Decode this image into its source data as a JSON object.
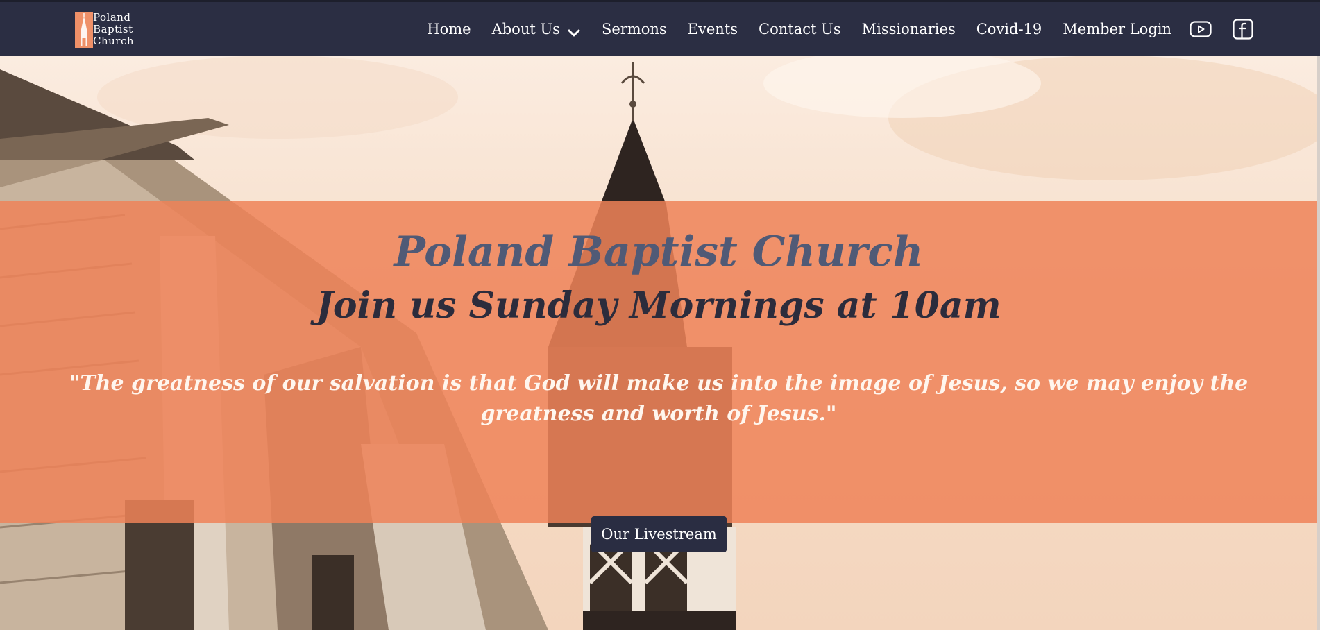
{
  "logo": {
    "lines": [
      "Poland",
      "Baptist",
      "Church"
    ]
  },
  "nav": {
    "items": [
      {
        "label": "Home"
      },
      {
        "label": "About Us"
      },
      {
        "label": "Sermons"
      },
      {
        "label": "Events"
      },
      {
        "label": "Contact Us"
      },
      {
        "label": "Missionaries"
      },
      {
        "label": "Covid-19"
      },
      {
        "label": "Member Login"
      }
    ],
    "social": [
      "youtube-icon",
      "facebook-icon"
    ]
  },
  "hero": {
    "title": "Poland Baptist Church",
    "subtitle": "Join us Sunday Mornings at 10am",
    "quote": "\"The greatness of our salvation is that God will make us into the image of Jesus, so we may enjoy the greatness and worth of Jesus.\"",
    "cta_label": "Our Livestream"
  },
  "colors": {
    "navbar": "#2b2e43",
    "banner": "#ee8358",
    "button": "#2a2d42",
    "title": "#505a76"
  }
}
